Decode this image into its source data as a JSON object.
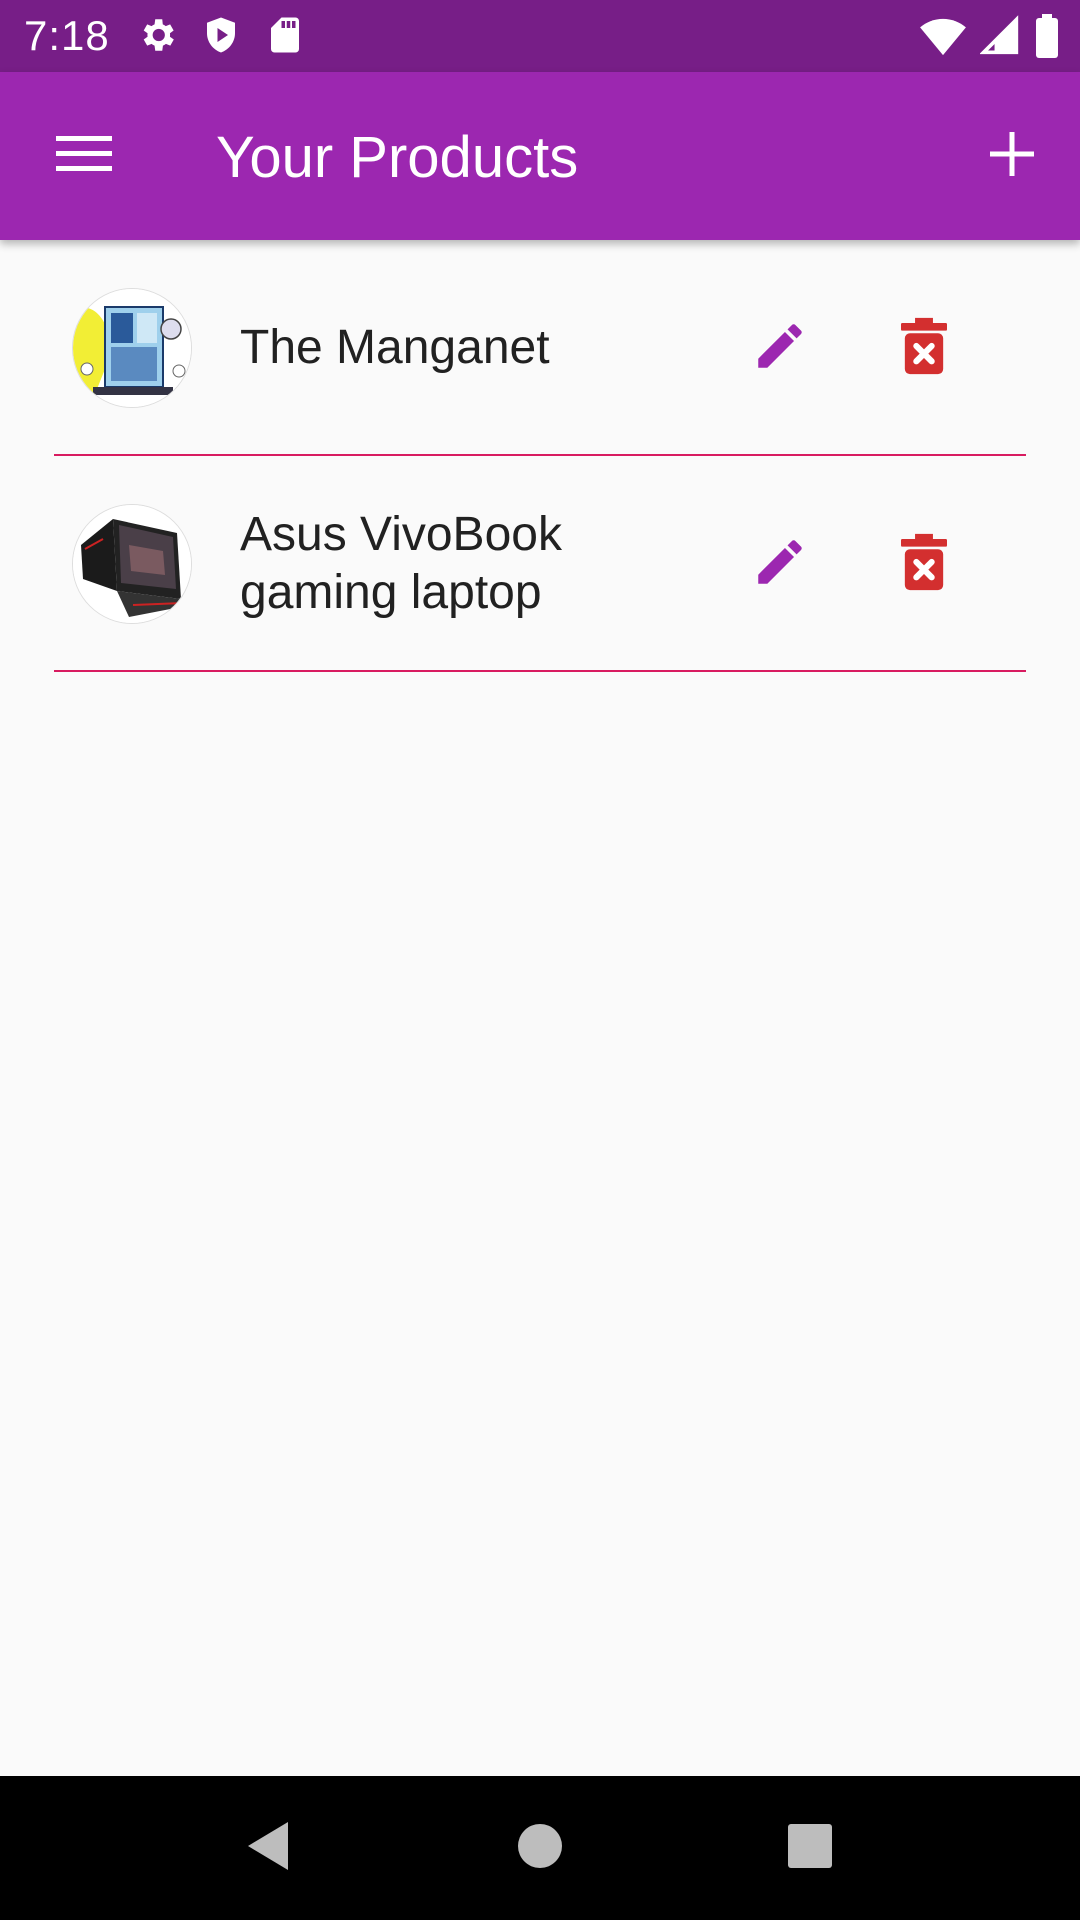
{
  "status_bar": {
    "time": "7:18",
    "left_icons": [
      "gear-icon",
      "shield-play-icon",
      "sd-card-icon"
    ],
    "right_icons": [
      "wifi-icon",
      "cell-signal-icon",
      "battery-icon"
    ],
    "background": "#771e87"
  },
  "app_bar": {
    "title": "Your Products",
    "menu_icon": "hamburger-menu-icon",
    "add_icon": "plus-icon",
    "background": "#9c27b0"
  },
  "products": [
    {
      "title": "The Manganet",
      "thumbnail": "manga-thumbnail",
      "edit_icon": "pencil-icon",
      "delete_icon": "trash-x-icon"
    },
    {
      "title": "Asus VivoBook gaming laptop",
      "thumbnail": "laptop-thumbnail",
      "edit_icon": "pencil-icon",
      "delete_icon": "trash-x-icon"
    }
  ],
  "colors": {
    "accent": "#9c27b0",
    "divider": "#d81b60",
    "delete": "#d32f2f",
    "text": "#212121"
  },
  "nav_bar": {
    "buttons": [
      "back-triangle-icon",
      "home-circle-icon",
      "recents-square-icon"
    ]
  }
}
